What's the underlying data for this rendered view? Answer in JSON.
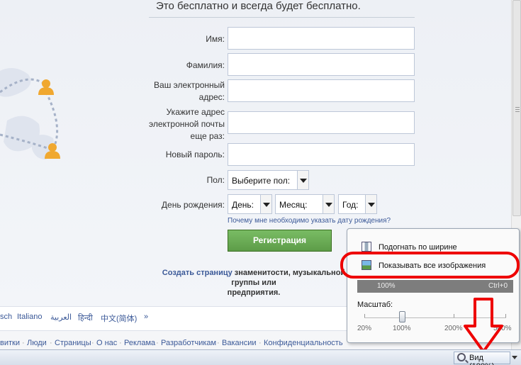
{
  "page": {
    "tagline": "Это бесплатно и всегда будет бесплатно.",
    "form": {
      "first_name_label": "Имя:",
      "last_name_label": "Фамилия:",
      "email_label": "Ваш электронный адрес:",
      "email_confirm_label": "Укажите адрес электронной почты еще раз:",
      "password_label": "Новый пароль:",
      "sex_label": "Пол:",
      "sex_value": "Выберите пол:",
      "birthday_label": "День рождения:",
      "day_value": "День:",
      "month_value": "Месяц:",
      "year_value": "Год:",
      "birthday_why": "Почему мне необходимо указать дату рождения?",
      "register_button": "Регистрация"
    },
    "create_page": {
      "link": "Создать страницу",
      "line1_rest": " знаменитости, музыкальной группы или",
      "line2": "предприятия."
    },
    "languages": [
      "sch",
      "Italiano",
      "العربية",
      "हिन्दी",
      "中文(简体)",
      "»"
    ],
    "footer_links": [
      "витки",
      "Люди",
      "Страницы",
      "О нас",
      "Реклама",
      "Разработчикам",
      "Вакансии",
      "Конфиденциальность"
    ]
  },
  "statusbar": {
    "zoom_label": "Вид (100%)"
  },
  "zoom_menu": {
    "fit_width": "Подогнать по ширине",
    "show_all_images": "Показывать все изображения",
    "current_level": "100%",
    "shortcut": "Ctrl+0",
    "scale_label": "Масштаб:",
    "marks": [
      "20%",
      "100%",
      "200%",
      "500%"
    ],
    "zoom_percent": 100
  },
  "colors": {
    "link": "#3b5998",
    "register_green": "#69a74e",
    "highlight_red": "#e00000"
  }
}
